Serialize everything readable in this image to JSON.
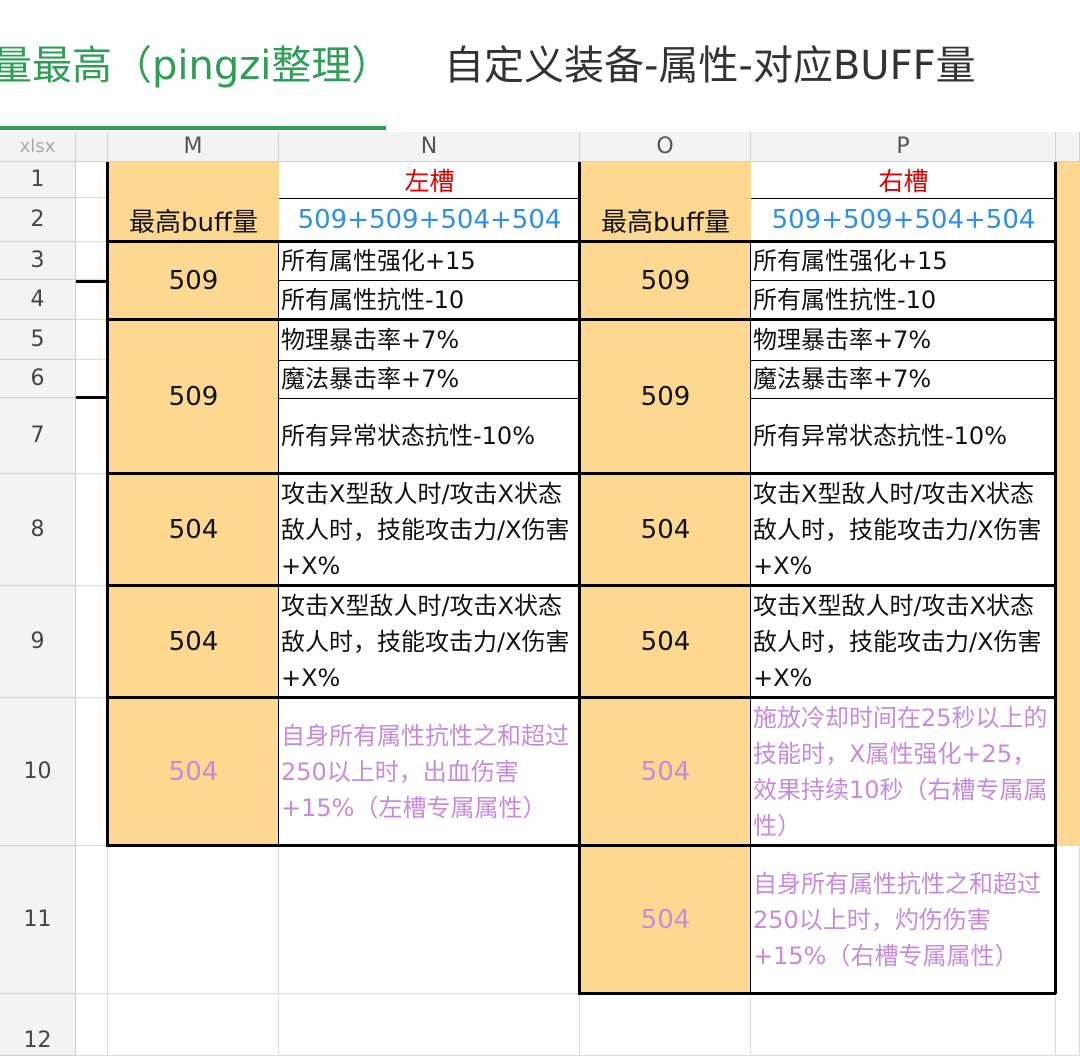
{
  "tabs": {
    "active": "量最高（pingzi整理）",
    "inactive": "自定义装备-属性-对应BUFF量"
  },
  "sheet": {
    "corner": "xlsx",
    "columns": [
      "M",
      "N",
      "O",
      "P"
    ],
    "rows": [
      "1",
      "2",
      "3",
      "4",
      "5",
      "6",
      "7",
      "8",
      "9",
      "10",
      "11",
      "12"
    ]
  },
  "cells": {
    "n1": "左槽",
    "p1": "右槽",
    "m2": "最高buff量",
    "n2": "509+509+504+504",
    "o2": "最高buff量",
    "p2": "509+509+504+504",
    "m3": "509",
    "n3": "所有属性强化+15",
    "n4": "所有属性抗性-10",
    "o3": "509",
    "p3": "所有属性强化+15",
    "p4": "所有属性抗性-10",
    "m5": "509",
    "n5": "物理暴击率+7%",
    "n6": "魔法暴击率+7%",
    "n7": "所有异常状态抗性-10%",
    "o5": "509",
    "p5": "物理暴击率+7%",
    "p6": "魔法暴击率+7%",
    "p7": "所有异常状态抗性-10%",
    "m8": "504",
    "n8": "攻击X型敌人时/攻击X状态敌人时，技能攻击力/X伤害+X%",
    "o8": "504",
    "p8": "攻击X型敌人时/攻击X状态敌人时，技能攻击力/X伤害+X%",
    "m9": "504",
    "n9": "攻击X型敌人时/攻击X状态敌人时，技能攻击力/X伤害+X%",
    "o9": "504",
    "p9": "攻击X型敌人时/攻击X状态敌人时，技能攻击力/X伤害+X%",
    "m10": "504",
    "n10": "自身所有属性抗性之和超过250以上时，出血伤害+15%（左槽专属属性）",
    "o10": "504",
    "p10": "施放冷却时间在25秒以上的技能时，X属性强化+25，效果持续10秒（右槽专属属性）",
    "o11": "504",
    "p11": "自身所有属性抗性之和超过250以上时，灼伤伤害+15%（右槽专属属性）"
  },
  "colors": {
    "accent_green": "#2e9e55",
    "header_fill": "#fcd890",
    "red_text": "#e00000",
    "blue_text": "#2f8fe8",
    "purple_text": "#c58be0"
  }
}
